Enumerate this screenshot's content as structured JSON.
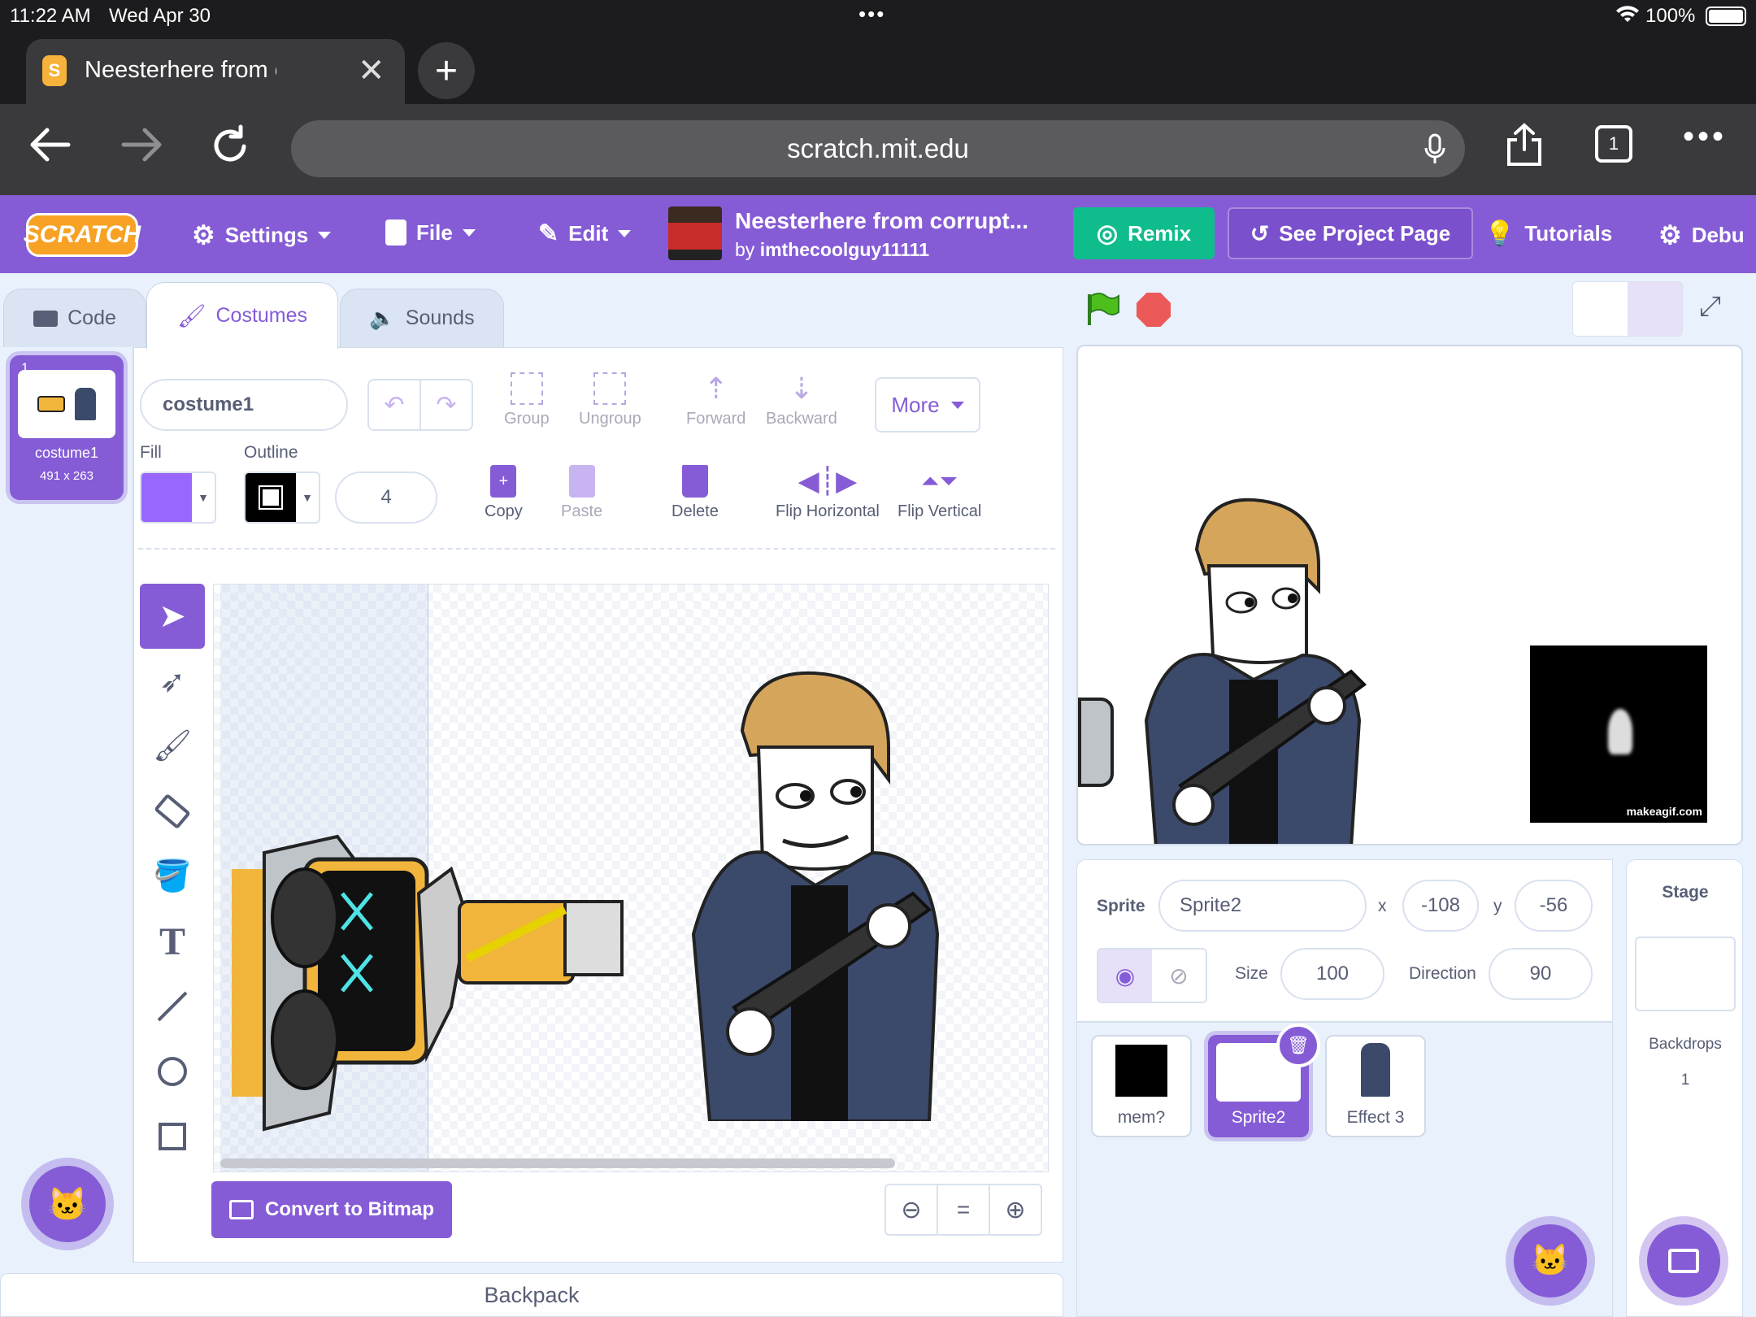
{
  "status": {
    "time": "11:22 AM",
    "date": "Wed Apr 30",
    "dots": "•••",
    "battery": "100%"
  },
  "browser": {
    "tab_title": "Neesterhere from corrup",
    "url": "scratch.mit.edu",
    "tab_count": "1"
  },
  "menu": {
    "settings": "Settings",
    "file": "File",
    "edit": "Edit",
    "project_title": "Neesterhere from corrupt...",
    "author_prefix": "by",
    "author": "imthecoolguy11111",
    "remix": "Remix",
    "see_project": "See Project Page",
    "tutorials": "Tutorials",
    "debug": "Debu"
  },
  "tabs": {
    "code": "Code",
    "costumes": "Costumes",
    "sounds": "Sounds"
  },
  "costume": {
    "index": "1",
    "name": "costume1",
    "size": "491 x 263"
  },
  "editor": {
    "name_value": "costume1",
    "group": "Group",
    "ungroup": "Ungroup",
    "forward": "Forward",
    "backward": "Backward",
    "more": "More",
    "fill": "Fill",
    "outline": "Outline",
    "outline_width": "4",
    "copy": "Copy",
    "paste": "Paste",
    "delete": "Delete",
    "flip_h": "Flip Horizontal",
    "flip_v": "Flip Vertical",
    "convert": "Convert to Bitmap",
    "zoom_reset": "="
  },
  "backpack": "Backpack",
  "stage": {
    "watermark": "makeagif.com"
  },
  "sprite_info": {
    "sprite_label": "Sprite",
    "sprite_name": "Sprite2",
    "x_label": "x",
    "x": "-108",
    "y_label": "y",
    "y": "-56",
    "size_label": "Size",
    "size": "100",
    "direction_label": "Direction",
    "direction": "90"
  },
  "sprites": [
    {
      "name": "mem?"
    },
    {
      "name": "Sprite2"
    },
    {
      "name": "Effect 3"
    }
  ],
  "stage_panel": {
    "title": "Stage",
    "backdrops_label": "Backdrops",
    "backdrops_count": "1"
  },
  "colors": {
    "accent": "#855cd6",
    "remix": "#0fbd8c",
    "fill_swatch": "#9966ff",
    "outline_swatch": "#000000"
  }
}
